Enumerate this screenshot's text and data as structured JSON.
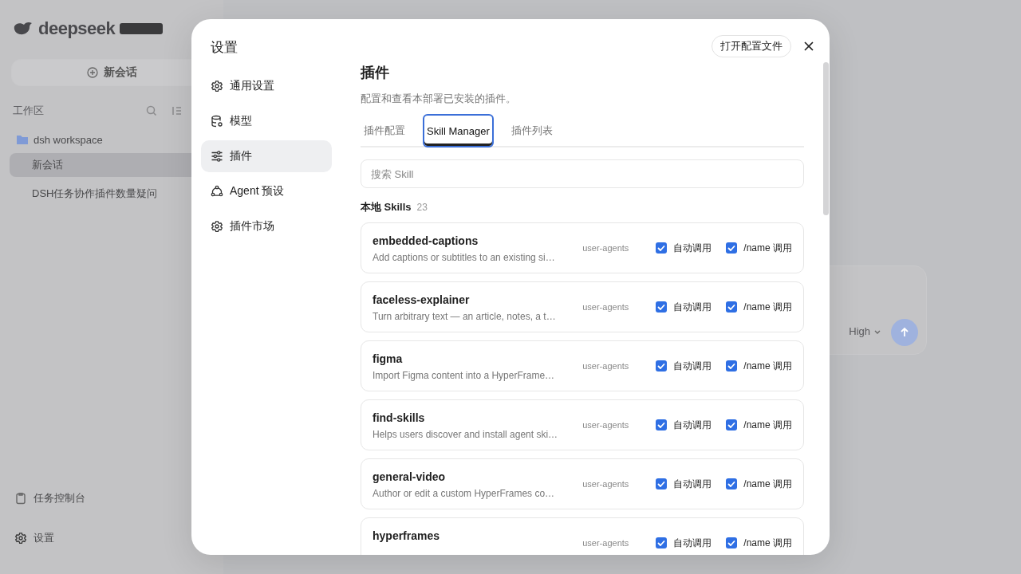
{
  "background": {
    "logo": "deepseek",
    "new_chat": "新会话",
    "workspace_label": "工作区",
    "project": "dsh workspace",
    "sessions": [
      {
        "title": "新会话",
        "selected": true
      },
      {
        "title": "DSH任务协作插件数量疑问",
        "selected": false
      }
    ],
    "footer": [
      {
        "label": "任务控制台",
        "kind": "console"
      },
      {
        "label": "设置",
        "kind": "settings"
      }
    ],
    "composer": {
      "effort": "High"
    }
  },
  "dialog": {
    "title": "设置",
    "open_config": "打开配置文件",
    "nav": [
      {
        "label": "通用设置",
        "kind": "gear",
        "selected": false
      },
      {
        "label": "模型",
        "kind": "database",
        "selected": false
      },
      {
        "label": "插件",
        "kind": "sliders",
        "selected": true
      },
      {
        "label": "Agent 预设",
        "kind": "agent",
        "selected": false
      },
      {
        "label": "插件市场",
        "kind": "gear",
        "selected": false
      }
    ],
    "heading": "插件",
    "description": "配置和查看本部署已安装的插件。",
    "tabs": [
      {
        "label": "插件配置",
        "selected": false
      },
      {
        "label": "Skill Manager",
        "selected": true
      },
      {
        "label": "插件列表",
        "selected": false
      }
    ],
    "search": {
      "placeholder": "搜索 Skill"
    },
    "section": {
      "title": "本地 Skills",
      "count": "23"
    },
    "skills": [
      {
        "name": "embedded-captions",
        "description": "Add captions or subtitles to an existing si…",
        "source": "user-agents",
        "options": [
          {
            "label": "自动调用",
            "checked": true
          },
          {
            "label": "/name 调用",
            "checked": true
          }
        ]
      },
      {
        "name": "faceless-explainer",
        "description": "Turn arbitrary text — an article, notes, a t…",
        "source": "user-agents",
        "options": [
          {
            "label": "自动调用",
            "checked": true
          },
          {
            "label": "/name 调用",
            "checked": true
          }
        ]
      },
      {
        "name": "figma",
        "description": "Import Figma content into a HyperFrame…",
        "source": "user-agents",
        "options": [
          {
            "label": "自动调用",
            "checked": true
          },
          {
            "label": "/name 调用",
            "checked": true
          }
        ]
      },
      {
        "name": "find-skills",
        "description": "Helps users discover and install agent ski…",
        "source": "user-agents",
        "options": [
          {
            "label": "自动调用",
            "checked": true
          },
          {
            "label": "/name 调用",
            "checked": true
          }
        ]
      },
      {
        "name": "general-video",
        "description": "Author or edit a custom HyperFrames co…",
        "source": "user-agents",
        "options": [
          {
            "label": "自动调用",
            "checked": true
          },
          {
            "label": "/name 调用",
            "checked": true
          }
        ]
      },
      {
        "name": "hyperframes",
        "source": "user-agents",
        "options": [
          {
            "label": "自动调用",
            "checked": true
          },
          {
            "label": "/name 调用",
            "checked": true
          }
        ]
      }
    ]
  }
}
